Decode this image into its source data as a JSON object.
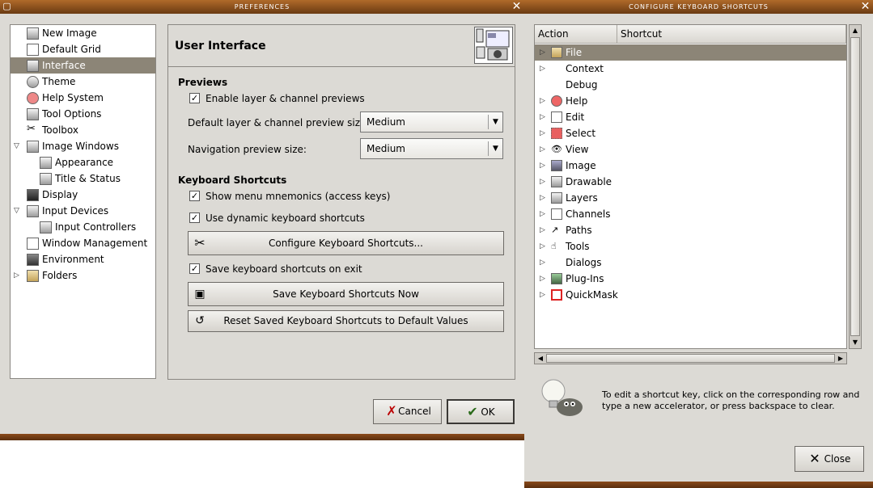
{
  "prefs": {
    "title": "PREFERENCES",
    "sidebar": {
      "items": [
        {
          "label": "New Image"
        },
        {
          "label": "Default Grid"
        },
        {
          "label": "Interface"
        },
        {
          "label": "Theme"
        },
        {
          "label": "Help System"
        },
        {
          "label": "Tool Options"
        },
        {
          "label": "Toolbox"
        },
        {
          "label": "Image Windows"
        },
        {
          "label": "Appearance"
        },
        {
          "label": "Title & Status"
        },
        {
          "label": "Display"
        },
        {
          "label": "Input Devices"
        },
        {
          "label": "Input Controllers"
        },
        {
          "label": "Window Management"
        },
        {
          "label": "Environment"
        },
        {
          "label": "Folders"
        }
      ]
    },
    "page_title": "User Interface",
    "previews": {
      "title": "Previews",
      "enable_label": "Enable layer & channel previews",
      "size_label": "Default layer & channel preview size:",
      "size_value": "Medium",
      "nav_label": "Navigation preview size:",
      "nav_value": "Medium"
    },
    "keyboard": {
      "title": "Keyboard Shortcuts",
      "mnemonics_label": "Show menu mnemonics (access keys)",
      "dynamic_label": "Use dynamic keyboard shortcuts",
      "configure_label": "Configure Keyboard Shortcuts...",
      "save_exit_label": "Save keyboard shortcuts on exit",
      "save_now_label": "Save Keyboard Shortcuts Now",
      "reset_label": "Reset Saved Keyboard Shortcuts to Default Values"
    },
    "cancel_label": "Cancel",
    "ok_label": "OK"
  },
  "kbd": {
    "title": "CONFIGURE KEYBOARD SHORTCUTS",
    "col_action": "Action",
    "col_shortcut": "Shortcut",
    "actions": [
      {
        "label": "File"
      },
      {
        "label": "Context"
      },
      {
        "label": "Debug"
      },
      {
        "label": "Help"
      },
      {
        "label": "Edit"
      },
      {
        "label": "Select"
      },
      {
        "label": "View"
      },
      {
        "label": "Image"
      },
      {
        "label": "Drawable"
      },
      {
        "label": "Layers"
      },
      {
        "label": "Channels"
      },
      {
        "label": "Paths"
      },
      {
        "label": "Tools"
      },
      {
        "label": "Dialogs"
      },
      {
        "label": "Plug-Ins"
      },
      {
        "label": "QuickMask"
      }
    ],
    "hint": "To edit a shortcut key, click on the corresponding row and type a new accelerator, or press backspace to clear.",
    "close_label": "Close"
  }
}
